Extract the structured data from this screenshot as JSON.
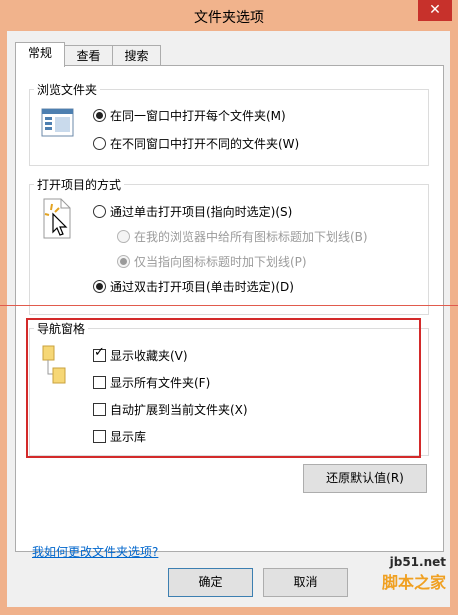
{
  "window": {
    "title": "文件夹选项",
    "close_icon": "close-icon"
  },
  "tabs": [
    {
      "label": "常规"
    },
    {
      "label": "查看"
    },
    {
      "label": "搜索"
    }
  ],
  "browse_group": {
    "title": "浏览文件夹",
    "options": [
      {
        "label": "在同一窗口中打开每个文件夹(M)",
        "checked": true
      },
      {
        "label": "在不同窗口中打开不同的文件夹(W)",
        "checked": false
      }
    ]
  },
  "open_group": {
    "title": "打开项目的方式",
    "options": [
      {
        "label": "通过单击打开项目(指向时选定)(S)",
        "checked": false,
        "enabled": true
      },
      {
        "label": "在我的浏览器中给所有图标标题加下划线(B)",
        "checked": false,
        "enabled": false
      },
      {
        "label": "仅当指向图标标题时加下划线(P)",
        "checked": true,
        "enabled": false
      },
      {
        "label": "通过双击打开项目(单击时选定)(D)",
        "checked": true,
        "enabled": true
      }
    ]
  },
  "nav_group": {
    "title": "导航窗格",
    "options": [
      {
        "label": "显示收藏夹(V)",
        "checked": true
      },
      {
        "label": "显示所有文件夹(F)",
        "checked": false
      },
      {
        "label": "自动扩展到当前文件夹(X)",
        "checked": false
      },
      {
        "label": "显示库",
        "checked": false
      }
    ]
  },
  "restore_button": "还原默认值(R)",
  "help_link": "我如何更改文件夹选项?",
  "ok_button": "确定",
  "cancel_button": "取消",
  "watermark": {
    "url": "jb51.net",
    "text": "脚本之家"
  }
}
